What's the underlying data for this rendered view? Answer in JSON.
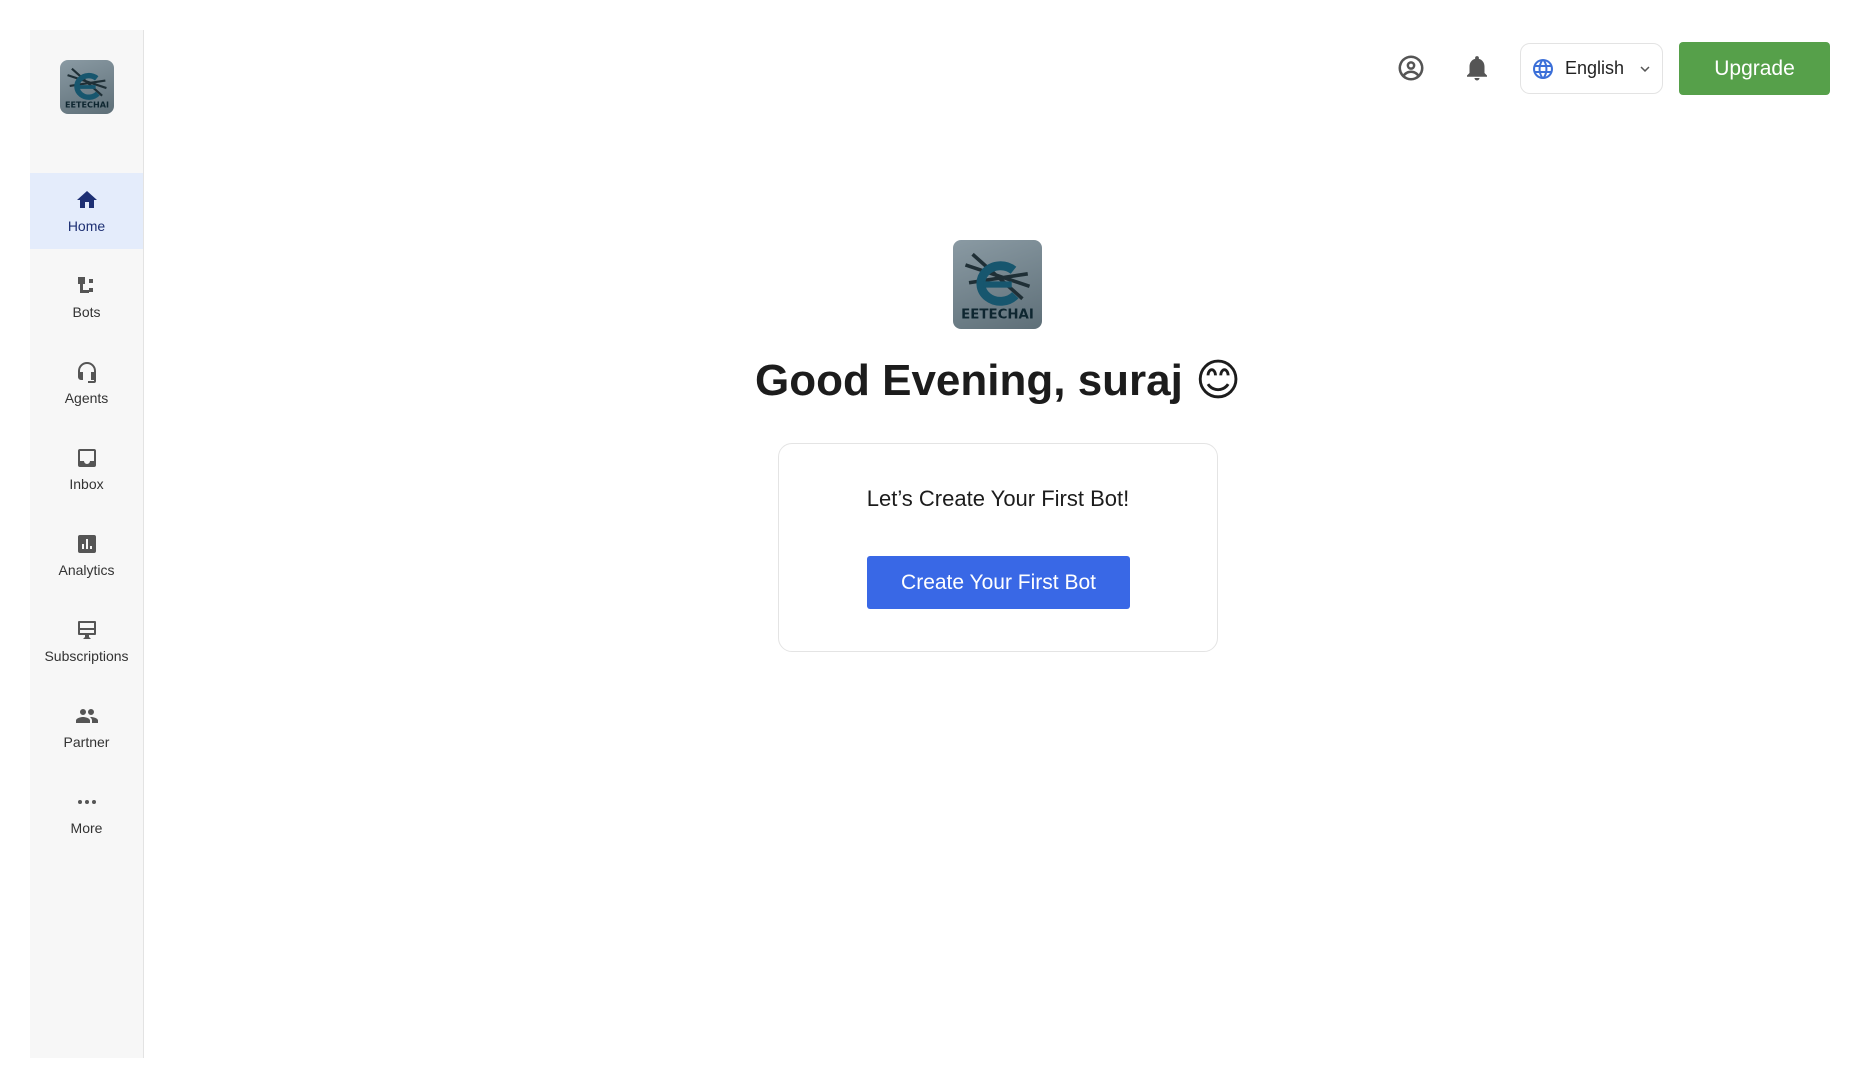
{
  "brand": {
    "logo_text": "EETECHAI"
  },
  "sidebar": {
    "items": [
      {
        "label": "Home",
        "icon": "home-icon",
        "active": true
      },
      {
        "label": "Bots",
        "icon": "bots-icon"
      },
      {
        "label": "Agents",
        "icon": "agents-icon"
      },
      {
        "label": "Inbox",
        "icon": "inbox-icon"
      },
      {
        "label": "Analytics",
        "icon": "analytics-icon"
      },
      {
        "label": "Subscriptions",
        "icon": "subscriptions-icon"
      },
      {
        "label": "Partner",
        "icon": "partner-icon"
      },
      {
        "label": "More",
        "icon": "more-icon"
      }
    ]
  },
  "header": {
    "profile_icon": "account-circle-icon",
    "notifications_icon": "bell-icon",
    "language": {
      "label": "English",
      "icon": "globe-icon"
    },
    "upgrade_label": "Upgrade"
  },
  "main": {
    "greeting": "Good Evening, suraj 😊",
    "card": {
      "title": "Let’s Create Your First Bot!",
      "button_label": "Create Your First Bot"
    }
  },
  "colors": {
    "accent_blue": "#3968e6",
    "upgrade_green": "#56a04a",
    "active_nav_bg": "#e4ecfb",
    "active_nav_fg": "#1d2f73"
  }
}
